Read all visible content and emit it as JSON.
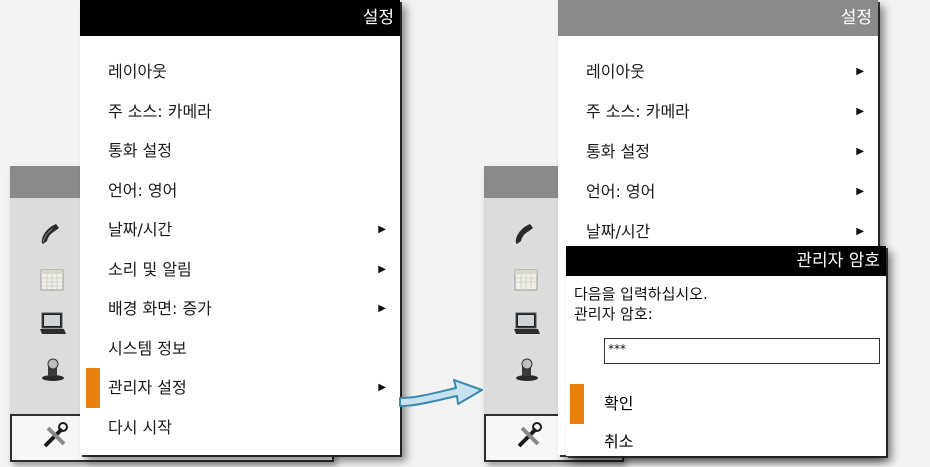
{
  "left_menu": {
    "title": "설정",
    "items": [
      {
        "label": "레이아웃",
        "submenu": false
      },
      {
        "label": "주 소스: 카메라",
        "submenu": false
      },
      {
        "label": "통화 설정",
        "submenu": false
      },
      {
        "label": "언어: 영어",
        "submenu": false
      },
      {
        "label": "날짜/시간",
        "submenu": true
      },
      {
        "label": "소리 및 알림",
        "submenu": true
      },
      {
        "label": "배경 화면: 증가",
        "submenu": true
      },
      {
        "label": "시스템 정보",
        "submenu": false
      },
      {
        "label": "관리자 설정",
        "submenu": true,
        "selected": true
      },
      {
        "label": "다시 시작",
        "submenu": false
      }
    ]
  },
  "right_menu": {
    "title": "설정",
    "items": [
      {
        "label": "레이아웃",
        "submenu": true
      },
      {
        "label": "주 소스: 카메라",
        "submenu": true
      },
      {
        "label": "통화 설정",
        "submenu": true
      },
      {
        "label": "언어: 영어",
        "submenu": true
      },
      {
        "label": "날짜/시간",
        "submenu": true
      }
    ]
  },
  "admin_dialog": {
    "title": "관리자 암호",
    "prompt_line1": "다음을 입력하십시오.",
    "prompt_line2": "관리자 암호:",
    "password_value": "***",
    "confirm_label": "확인",
    "cancel_label": "취소"
  },
  "sidebar_icons": [
    "phone-icon",
    "calendar-icon",
    "laptop-icon",
    "camera-icon",
    "tools-icon"
  ],
  "arrow_glyph": "▶",
  "colors": {
    "accent": "#e8820c",
    "title_bar_active": "#000000",
    "title_bar_inactive": "#8a8a8a",
    "transition_arrow": "#4a9cc0"
  }
}
